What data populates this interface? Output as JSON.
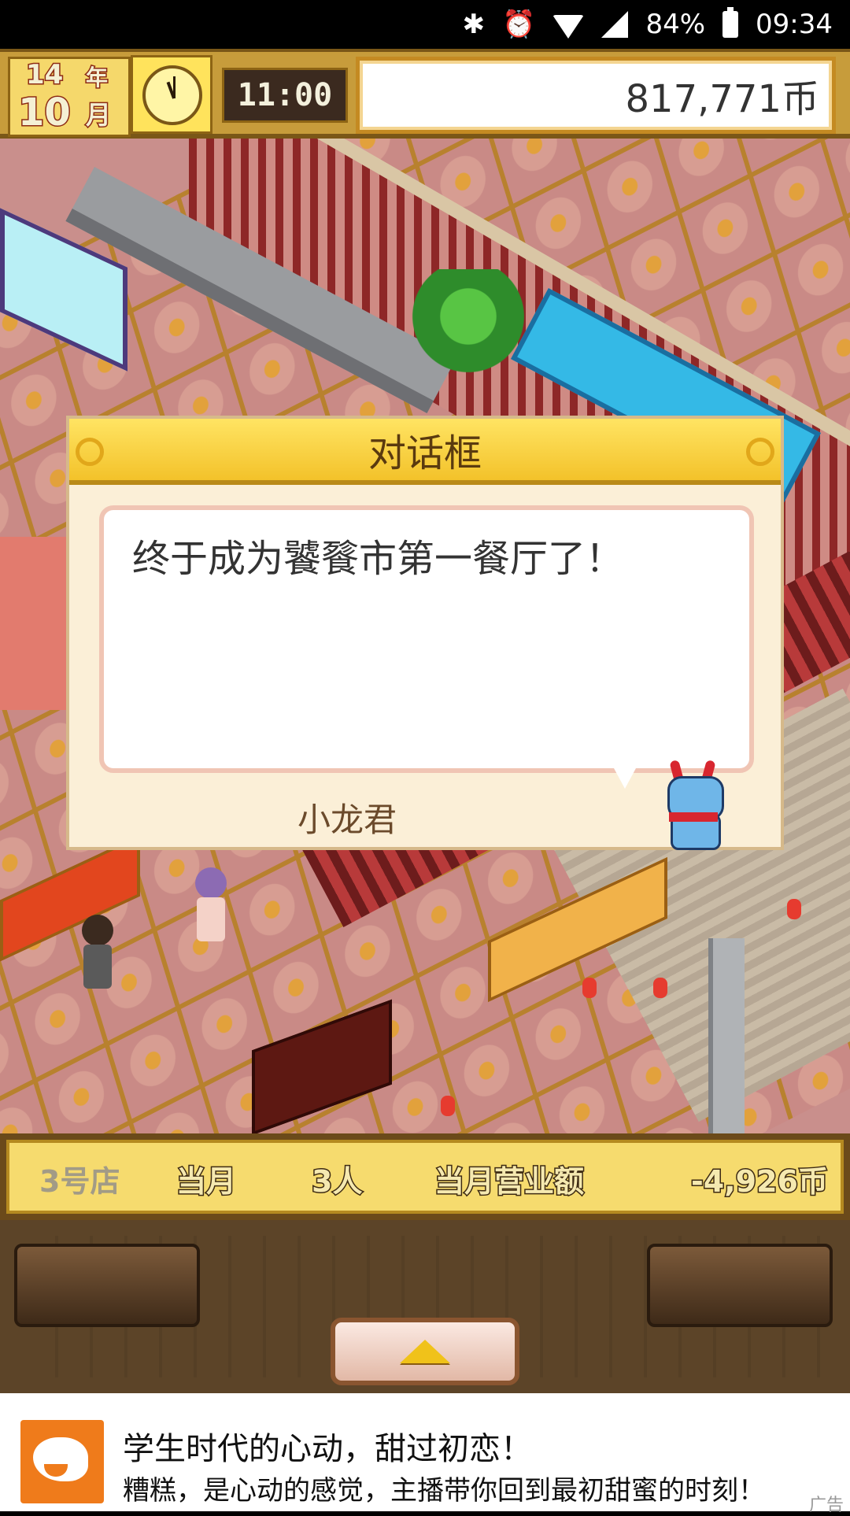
{
  "status_bar": {
    "battery": "84%",
    "time": "09:34"
  },
  "hud": {
    "year_num": "14",
    "year_label": "年",
    "month_num": "10",
    "month_label": "月",
    "time": "11:00",
    "money": "817,771币"
  },
  "dialog": {
    "title": "对话框",
    "message": "终于成为饕餮市第一餐厅了！",
    "speaker": "小龙君"
  },
  "info_bar": {
    "store": "3号店",
    "month_label": "当月",
    "customer_count": "3人",
    "sales_label": "当月营业额",
    "sales_value": "-4,926币"
  },
  "ad": {
    "title": "学生时代的心动，甜过初恋！",
    "subtitle": "糟糕，是心动的感觉，主播带你回到最初甜蜜的时刻！",
    "tag": "广告"
  }
}
